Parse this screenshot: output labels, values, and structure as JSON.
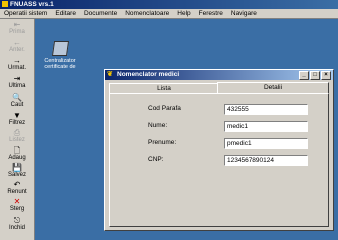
{
  "app": {
    "title": "FNUASS vrs.1"
  },
  "menu": [
    "Operatii sistem",
    "Editare",
    "Documente",
    "Nomenclatoare",
    "Help",
    "Ferestre",
    "Navigare"
  ],
  "toolbar": [
    {
      "label": "Prima",
      "icon": "first-icon",
      "enabled": false,
      "glyph": "⇤"
    },
    {
      "label": "Anter.",
      "icon": "prev-icon",
      "enabled": false,
      "glyph": "←"
    },
    {
      "label": "Urmat.",
      "icon": "next-icon",
      "enabled": true,
      "glyph": "→"
    },
    {
      "label": "Ultima",
      "icon": "last-icon",
      "enabled": true,
      "glyph": "⇥"
    },
    {
      "label": "Caut",
      "icon": "binoculars-icon",
      "enabled": true,
      "glyph": "🔍"
    },
    {
      "label": "Filtrez",
      "icon": "filter-icon",
      "enabled": true,
      "glyph": "▼"
    },
    {
      "label": "Listez",
      "icon": "printer-icon",
      "enabled": false,
      "glyph": "⎙"
    },
    {
      "label": "Adaug",
      "icon": "add-icon",
      "enabled": true,
      "glyph": "🗋"
    },
    {
      "label": "Salvez",
      "icon": "save-icon",
      "enabled": true,
      "glyph": "💾"
    },
    {
      "label": "Renunt",
      "icon": "undo-icon",
      "enabled": true,
      "glyph": "↶"
    },
    {
      "label": "Sterg",
      "icon": "delete-icon",
      "enabled": true,
      "glyph": "✕"
    },
    {
      "label": "Inchid",
      "icon": "close-door-icon",
      "enabled": true,
      "glyph": "⎋"
    }
  ],
  "desktop_icon": {
    "label": "Centralizator certificate de"
  },
  "window": {
    "title": "Nomenclator medici",
    "buttons": [
      "_",
      "□",
      "×"
    ],
    "tabs": [
      "Lista",
      "Detalii"
    ],
    "active_tab": "Detalii",
    "fields": [
      {
        "label": "Cod Parafa",
        "value": "432555"
      },
      {
        "label": "Nume:",
        "value": "medic1"
      },
      {
        "label": "Prenume:",
        "value": "pmedic1"
      },
      {
        "label": "CNP:",
        "value": "1234567890124"
      }
    ]
  },
  "colors": {
    "desktop": "#3a6ea5",
    "titlebar": "#0a246a",
    "face": "#d4d0c8"
  }
}
